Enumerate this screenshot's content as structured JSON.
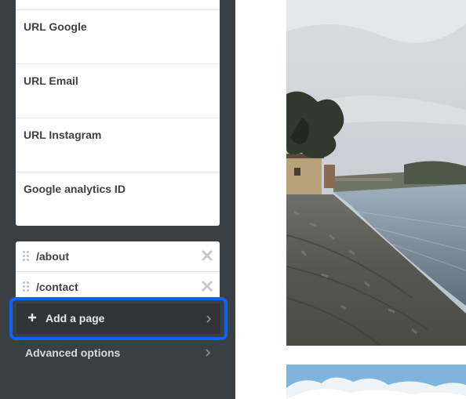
{
  "sidebar": {
    "fields": [
      {
        "label": "URL Google"
      },
      {
        "label": "URL Email"
      },
      {
        "label": "URL Instagram"
      },
      {
        "label": "Google analytics ID"
      }
    ],
    "pages": [
      {
        "path": "/about"
      },
      {
        "path": "/contact"
      }
    ],
    "add_page_label": "Add a page",
    "advanced_label": "Advanced options",
    "highlight_color": "#0a64f5"
  },
  "icons": {
    "drag": "drag-handle-icon",
    "remove": "close-icon",
    "plus": "plus-icon",
    "chevron": "chevron-right-icon"
  }
}
